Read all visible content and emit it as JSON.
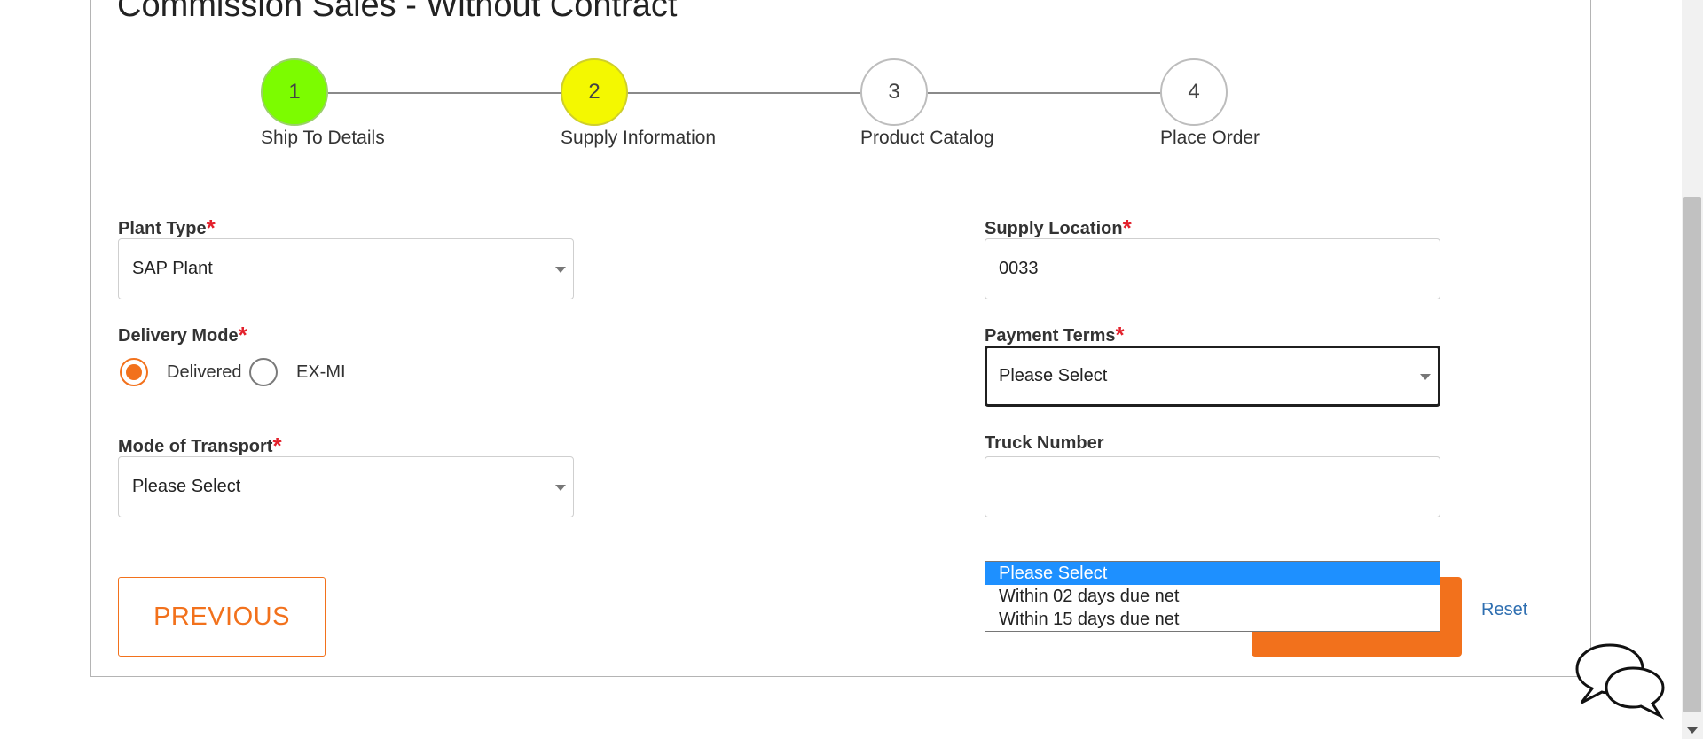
{
  "page": {
    "title": "Commission Sales - Without Contract"
  },
  "stepper": {
    "steps": [
      {
        "number": "1",
        "label": "Ship To Details",
        "color": "#7cfc00"
      },
      {
        "number": "2",
        "label": "Supply Information",
        "color": "#f4f800"
      },
      {
        "number": "3",
        "label": "Product Catalog",
        "color": "#ffffff"
      },
      {
        "number": "4",
        "label": "Place Order",
        "color": "#ffffff"
      }
    ]
  },
  "form": {
    "required_marker": "*",
    "plant_type": {
      "label": "Plant Type",
      "value": "SAP Plant"
    },
    "supply_location": {
      "label": "Supply Location",
      "value": "0033"
    },
    "delivery_mode": {
      "label": "Delivery Mode",
      "options": [
        {
          "label": "Delivered",
          "checked": true
        },
        {
          "label": "EX-MI",
          "checked": false
        }
      ]
    },
    "payment_terms": {
      "label": "Payment Terms",
      "value": "Please Select",
      "options": [
        "Please Select",
        "Within 02 days due net",
        "Within 15 days due net"
      ],
      "highlighted_index": 0
    },
    "mode_of_transport": {
      "label": "Mode of Transport",
      "value": "Please Select"
    },
    "truck_number": {
      "label": "Truck Number",
      "value": ""
    }
  },
  "buttons": {
    "previous": "PREVIOUS",
    "reset": "Reset"
  },
  "colors": {
    "accent": "#f2711c",
    "link": "#2f6fb1",
    "required": "#e3202b",
    "dropdown_highlight": "#1e90ff"
  },
  "icons": {
    "chat": "chat-bubbles-icon",
    "caret": "chevron-down-icon"
  }
}
